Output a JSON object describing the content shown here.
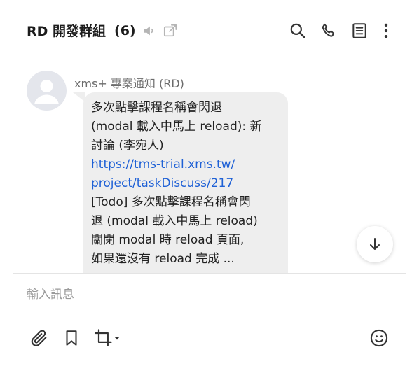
{
  "header": {
    "title": "RD 開發群組",
    "count": "(6)",
    "icons": [
      "mute-icon",
      "popout-icon",
      "search-icon",
      "phone-icon",
      "notes-icon",
      "more-vertical-icon"
    ]
  },
  "message": {
    "sender": "xms+ 專案通知 (RD)",
    "line1": "多次點擊課程名稱會閃退",
    "line2": "(modal 載入中馬上 reload): 新",
    "line3": "討論 (李宛人)",
    "link_line1": "https://tms-trial.xms.tw/",
    "link_line2": "project/taskDiscuss/217",
    "line4": "[Todo] 多次點擊課程名稱會閃",
    "line5": "退 (modal 載入中馬上 reload)",
    "line6": "關閉 modal 時 reload 頁面,",
    "line7": "如果還沒有 reload 完成 ..."
  },
  "composer": {
    "placeholder": "輸入訊息",
    "icons": [
      "paperclip-icon",
      "bookmark-icon",
      "crop-icon",
      "emoji-icon"
    ]
  },
  "colors": {
    "link": "#1f61d6",
    "bubble": "#eeeeee",
    "icon": "#333333",
    "muted_icon": "#b5b5b5"
  }
}
